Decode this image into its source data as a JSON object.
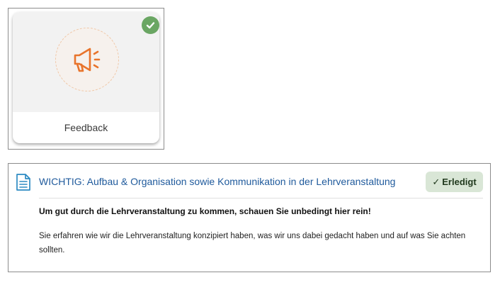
{
  "activity_tile": {
    "label": "Feedback",
    "icon": "megaphone-icon",
    "completed_icon": "check-circle-icon",
    "accent_color": "#e8742c",
    "completed_color": "#6aa663"
  },
  "notice": {
    "icon": "document-icon",
    "title": "WICHTIG: Aufbau & Organisation sowie Kommunikation in der Lehrveranstaltung",
    "status_label": "Erledigt",
    "headline": "Um gut durch die Lehrveranstaltung zu kommen, schauen Sie unbedingt hier rein!",
    "body": "Sie erfahren wie wir die Lehrveranstaltung konzipiert haben, was wir uns dabei gedacht haben und auf was Sie achten sollten.",
    "title_color": "#1f5a9c",
    "status_bg": "#d9e6d6"
  }
}
